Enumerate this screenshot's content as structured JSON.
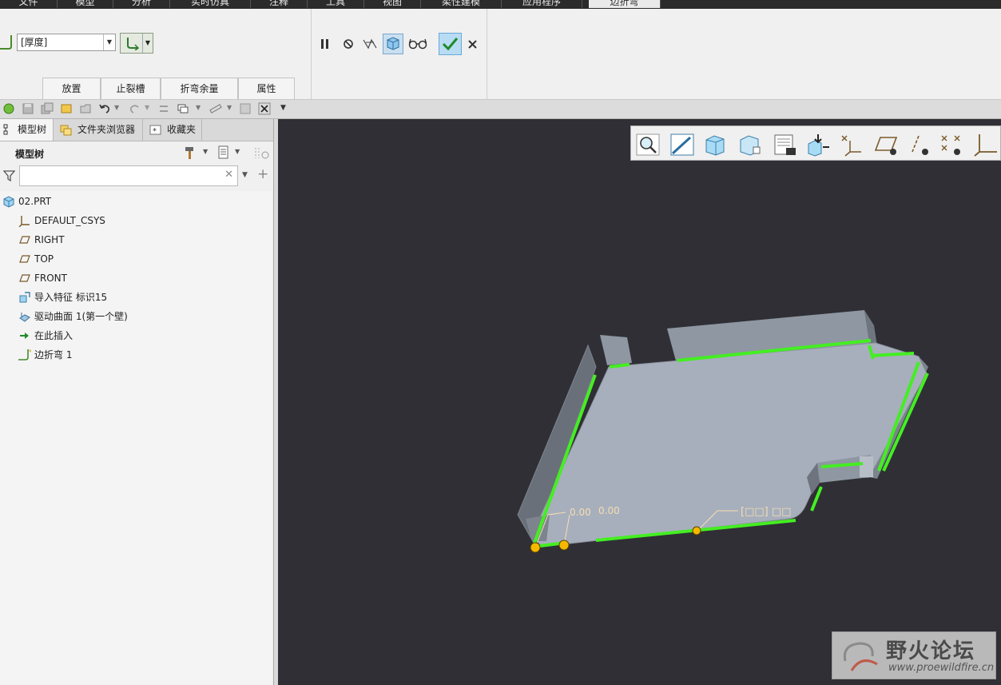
{
  "menu": {
    "tabs": [
      "文件",
      "模型",
      "分析",
      "实时仿真",
      "注释",
      "工具",
      "视图",
      "柔性建模",
      "应用程序",
      "边折弯"
    ],
    "active_tab": "边折弯"
  },
  "ribbon": {
    "thickness_select": "[厚度]",
    "sub_tabs": [
      "放置",
      "止裂槽",
      "折弯余量",
      "属性"
    ],
    "accent_color": "#6aa8d8"
  },
  "panel": {
    "tabs": [
      "模型树",
      "文件夹浏览器",
      "收藏夹"
    ],
    "tree_title": "模型树",
    "search_placeholder": ""
  },
  "tree": {
    "items": [
      {
        "label": "02.PRT",
        "icon": "part-icon"
      },
      {
        "label": "DEFAULT_CSYS",
        "icon": "csys-icon"
      },
      {
        "label": "RIGHT",
        "icon": "datum-plane-icon"
      },
      {
        "label": "TOP",
        "icon": "datum-plane-icon"
      },
      {
        "label": "FRONT",
        "icon": "datum-plane-icon"
      },
      {
        "label": "导入特征 标识15",
        "icon": "import-feature-icon"
      },
      {
        "label": "驱动曲面 1(第一个壁)",
        "icon": "driving-surface-icon"
      },
      {
        "label": "在此插入",
        "icon": "insert-here-arrow-icon"
      },
      {
        "label": "边折弯 1",
        "icon": "edge-bend-icon"
      }
    ]
  },
  "model": {
    "dim_label_1": "0.00",
    "dim_label_2": "0.00",
    "placeholder_label": "[□□] □□",
    "highlight_color": "#44ee22",
    "handle_color": "#f5b800"
  },
  "watermark": {
    "title": "野火论坛",
    "url": "www.proewildfire.cn"
  }
}
